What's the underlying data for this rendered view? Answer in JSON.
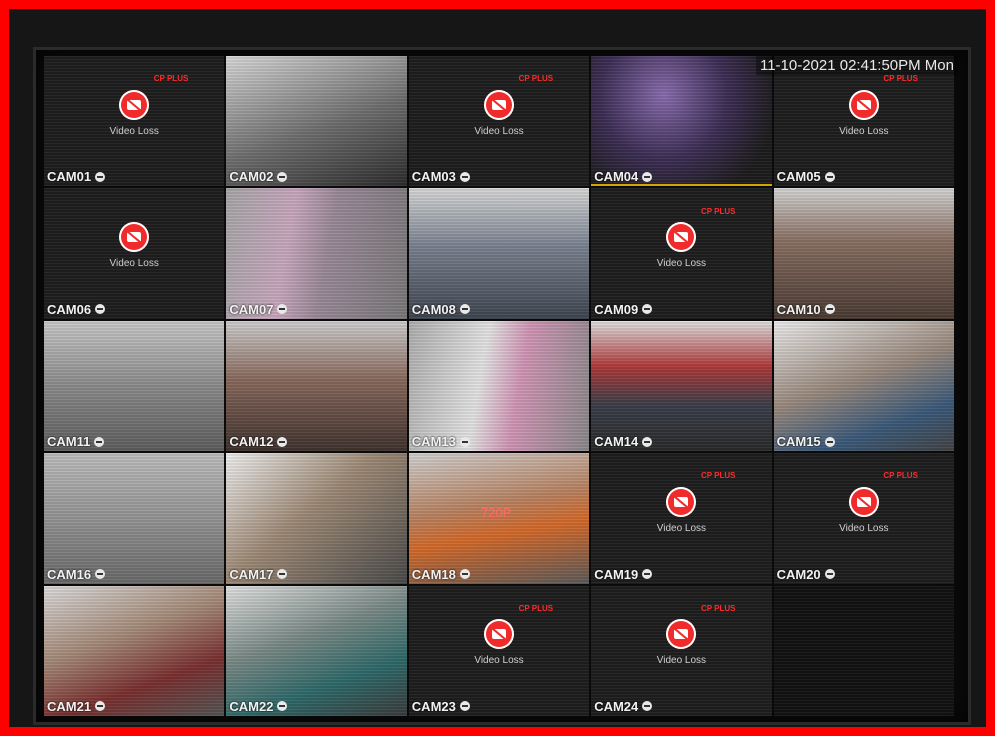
{
  "osd": {
    "datetime": "11-10-2021 02:41:50PM Mon"
  },
  "colors": {
    "frame_border": "#ff0000",
    "video_loss_icon": "#ef2b2b",
    "brand_text": "#ff2a2a",
    "selected_tile_bar": "#d4a400"
  },
  "video_loss": {
    "message": "Video Loss",
    "brand": "CP PLUS"
  },
  "cameras": [
    {
      "label": "CAM01",
      "status": "loss"
    },
    {
      "label": "CAM02",
      "status": "video"
    },
    {
      "label": "CAM03",
      "status": "loss"
    },
    {
      "label": "CAM04",
      "status": "video"
    },
    {
      "label": "CAM05",
      "status": "loss"
    },
    {
      "label": "CAM06",
      "status": "loss"
    },
    {
      "label": "CAM07",
      "status": "video"
    },
    {
      "label": "CAM08",
      "status": "video"
    },
    {
      "label": "CAM09",
      "status": "loss"
    },
    {
      "label": "CAM10",
      "status": "video"
    },
    {
      "label": "CAM11",
      "status": "video"
    },
    {
      "label": "CAM12",
      "status": "video"
    },
    {
      "label": "CAM13",
      "status": "video"
    },
    {
      "label": "CAM14",
      "status": "video"
    },
    {
      "label": "CAM15",
      "status": "video"
    },
    {
      "label": "CAM16",
      "status": "video"
    },
    {
      "label": "CAM17",
      "status": "video"
    },
    {
      "label": "CAM18",
      "status": "video"
    },
    {
      "label": "CAM19",
      "status": "loss"
    },
    {
      "label": "CAM20",
      "status": "loss"
    },
    {
      "label": "CAM21",
      "status": "video"
    },
    {
      "label": "CAM22",
      "status": "video"
    },
    {
      "label": "CAM23",
      "status": "loss"
    },
    {
      "label": "CAM24",
      "status": "loss"
    }
  ],
  "cam18_overlay": "720P"
}
